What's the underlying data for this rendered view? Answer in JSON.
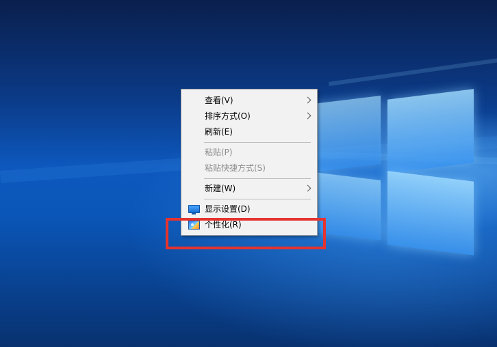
{
  "desktop": {
    "background": "windows-10-hero-wallpaper"
  },
  "context_menu": {
    "items": [
      {
        "label": "查看(V)",
        "has_submenu": true,
        "enabled": true
      },
      {
        "label": "排序方式(O)",
        "has_submenu": true,
        "enabled": true
      },
      {
        "label": "刷新(E)",
        "has_submenu": false,
        "enabled": true
      },
      {
        "label": "粘贴(P)",
        "has_submenu": false,
        "enabled": false
      },
      {
        "label": "粘贴快捷方式(S)",
        "has_submenu": false,
        "enabled": false
      },
      {
        "label": "新建(W)",
        "has_submenu": true,
        "enabled": true
      },
      {
        "label": "显示设置(D)",
        "icon": "display-settings-icon",
        "enabled": true
      },
      {
        "label": "个性化(R)",
        "icon": "personalize-icon",
        "enabled": true
      }
    ]
  },
  "annotation": {
    "highlight_color": "#e5332f",
    "highlighted_item": "个性化(R)"
  }
}
